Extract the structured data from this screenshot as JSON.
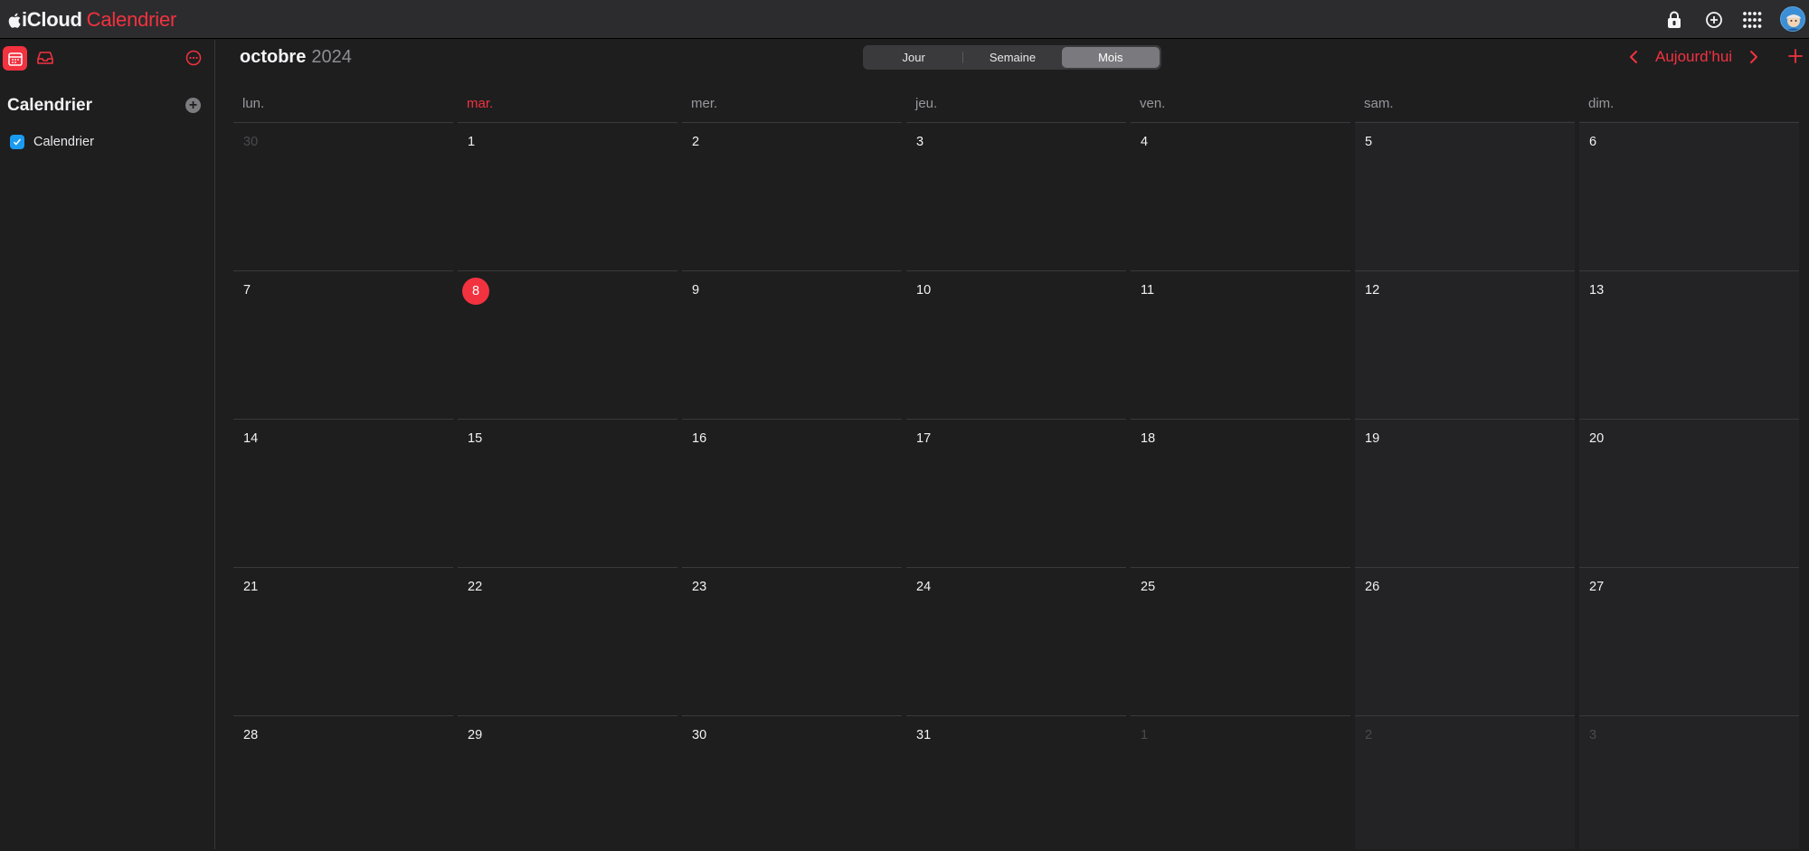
{
  "brand": {
    "icloud": "iCloud",
    "app": "Calendrier"
  },
  "topbar_icons": [
    "lock-icon",
    "plus-circle-icon",
    "grid-apps-icon",
    "avatar"
  ],
  "sidebar": {
    "title": "Calendrier",
    "add_label": "+",
    "calendars": [
      {
        "label": "Calendrier",
        "checked": true,
        "color": "#1a9bf0"
      }
    ]
  },
  "header": {
    "month": "octobre",
    "year": "2024",
    "views": [
      "Jour",
      "Semaine",
      "Mois"
    ],
    "active_view": "Mois",
    "today_label": "Aujourd’hui"
  },
  "colors": {
    "accent": "#f2323f",
    "background": "#1e1e1f",
    "topbar": "#2c2c2e"
  },
  "weekdays": [
    "lun.",
    "mar.",
    "mer.",
    "jeu.",
    "ven.",
    "sam.",
    "dim."
  ],
  "today_weekday_index": 1,
  "weeks": [
    [
      "30",
      "1",
      "2",
      "3",
      "4",
      "5",
      "6"
    ],
    [
      "7",
      "8",
      "9",
      "10",
      "11",
      "12",
      "13"
    ],
    [
      "14",
      "15",
      "16",
      "17",
      "18",
      "19",
      "20"
    ],
    [
      "21",
      "22",
      "23",
      "24",
      "25",
      "26",
      "27"
    ],
    [
      "28",
      "29",
      "30",
      "31",
      "1",
      "2",
      "3"
    ]
  ],
  "other_month_cells": [
    [
      0,
      0
    ],
    [
      4,
      4
    ],
    [
      4,
      5
    ],
    [
      4,
      6
    ]
  ],
  "today_cell": [
    1,
    1
  ]
}
